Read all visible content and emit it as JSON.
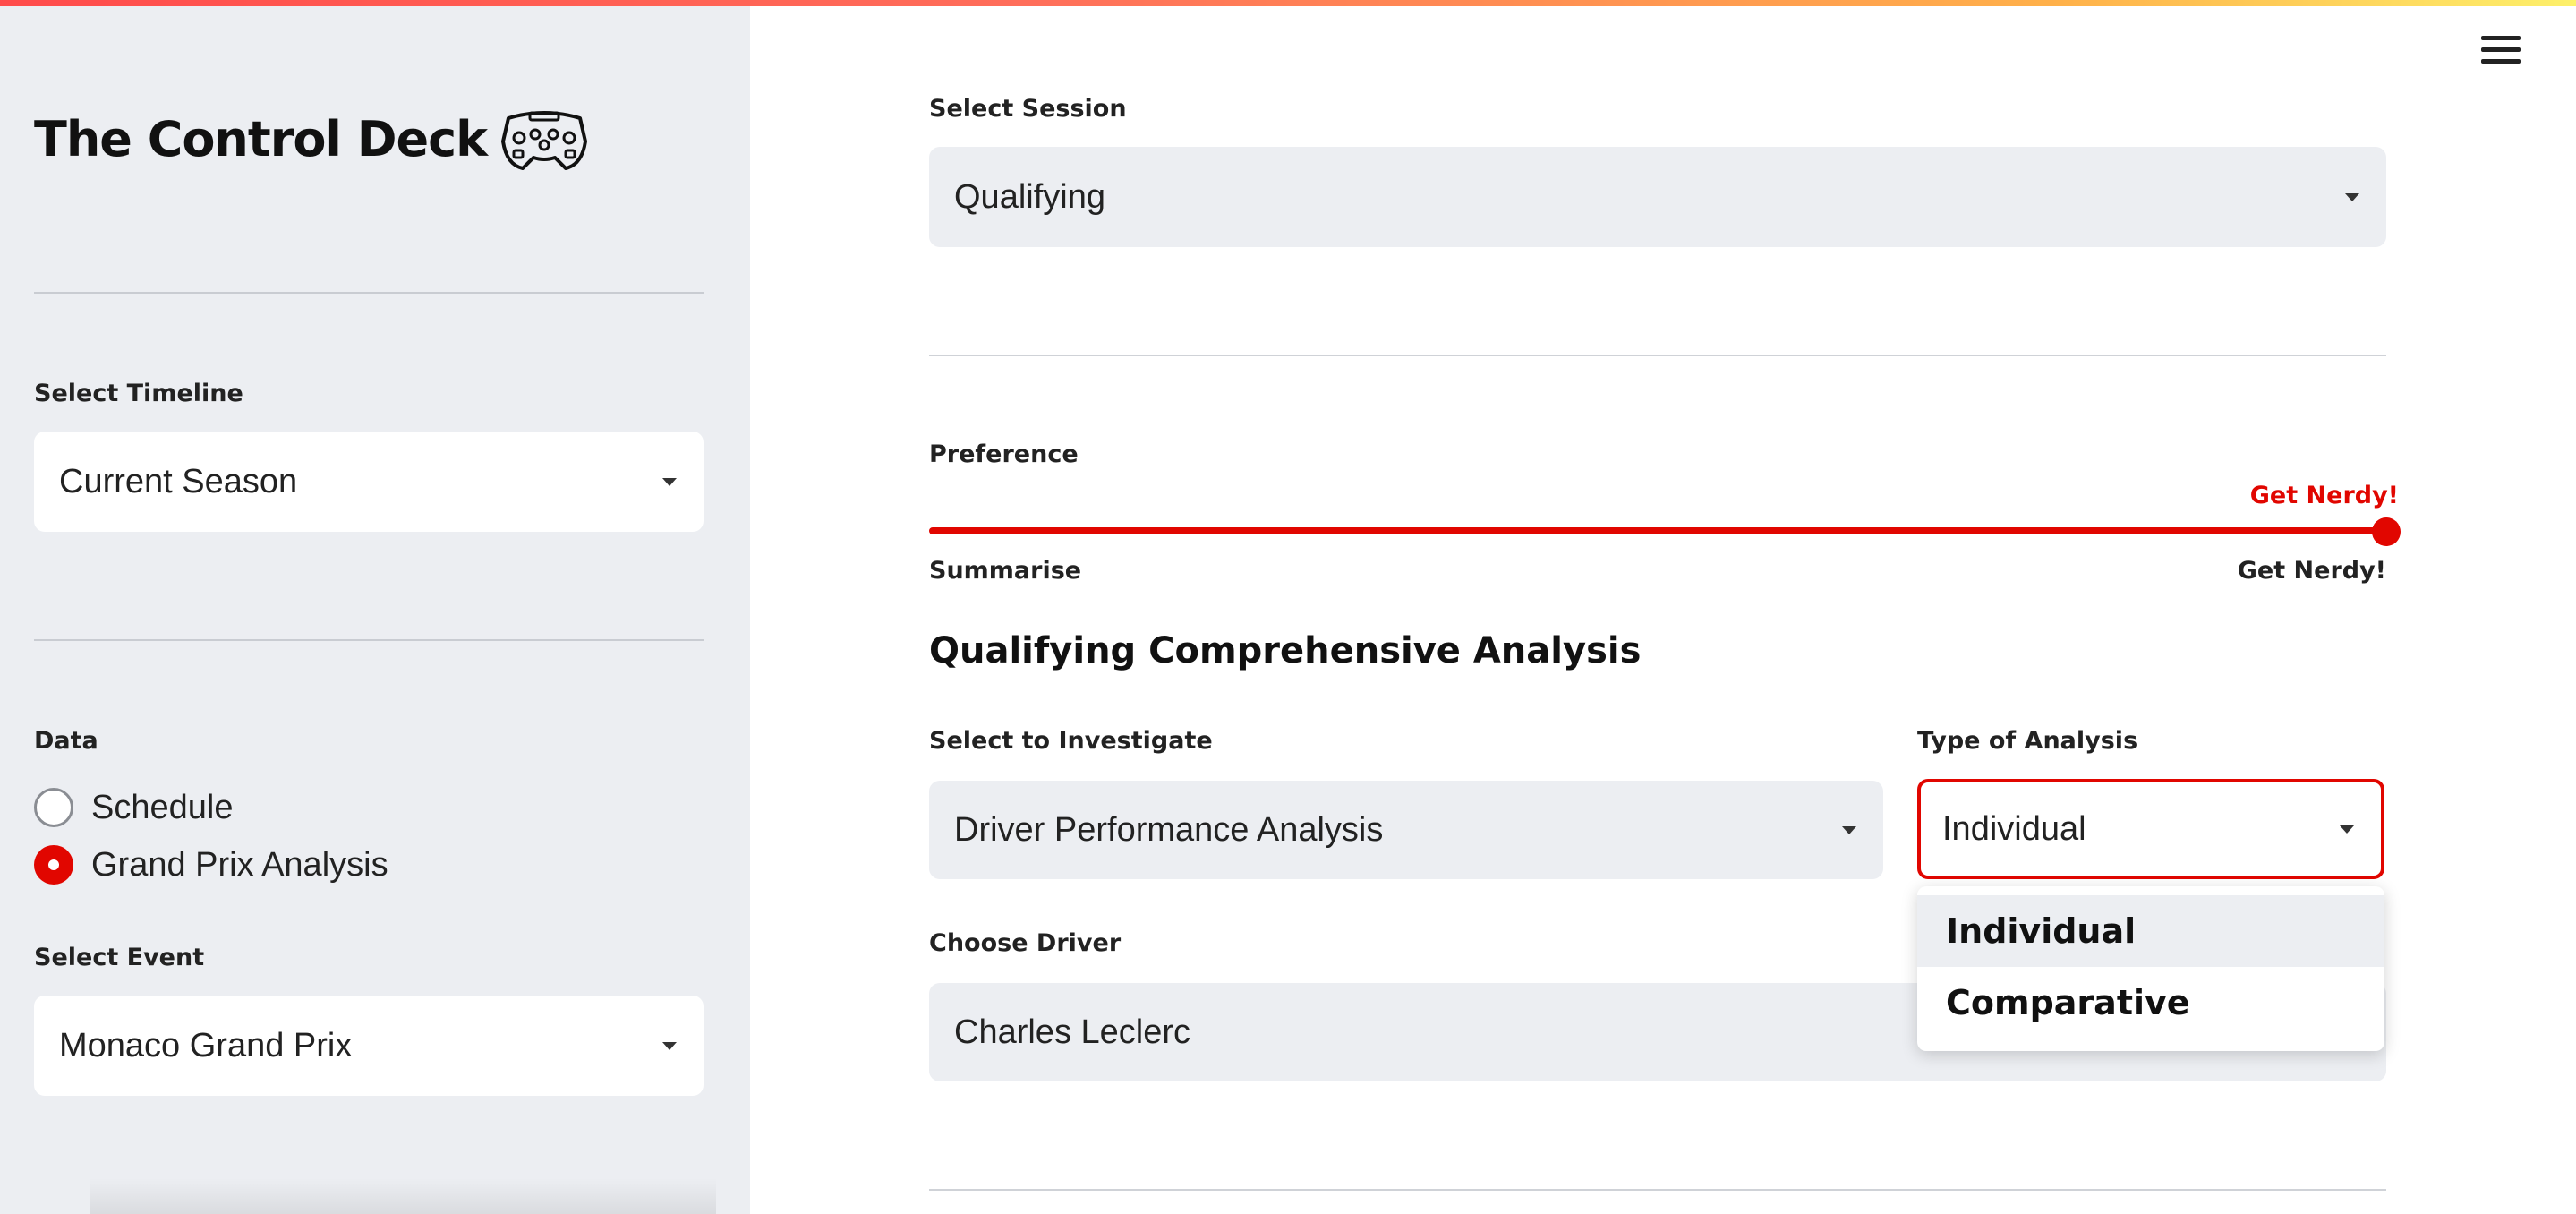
{
  "app": {
    "title": "The Control Deck",
    "accent_color": "#e10600"
  },
  "sidebar": {
    "timeline": {
      "label": "Select Timeline",
      "value": "Current Season"
    },
    "data": {
      "label": "Data",
      "options": [
        {
          "label": "Schedule",
          "checked": false
        },
        {
          "label": "Grand Prix Analysis",
          "checked": true
        }
      ]
    },
    "event": {
      "label": "Select Event",
      "value": "Monaco Grand Prix"
    }
  },
  "main": {
    "session": {
      "label": "Select Session",
      "value": "Qualifying"
    },
    "preference": {
      "label": "Preference",
      "current": "Get Nerdy!",
      "min_label": "Summarise",
      "max_label": "Get Nerdy!",
      "level_percent": 100
    },
    "section_title": "Qualifying Comprehensive Analysis",
    "investigate": {
      "label": "Select to Investigate",
      "value": "Driver Performance Analysis"
    },
    "analysis_type": {
      "label": "Type of Analysis",
      "value": "Individual",
      "options": [
        "Individual",
        "Comparative"
      ]
    },
    "driver": {
      "label": "Choose Driver",
      "value": "Charles Leclerc"
    }
  }
}
